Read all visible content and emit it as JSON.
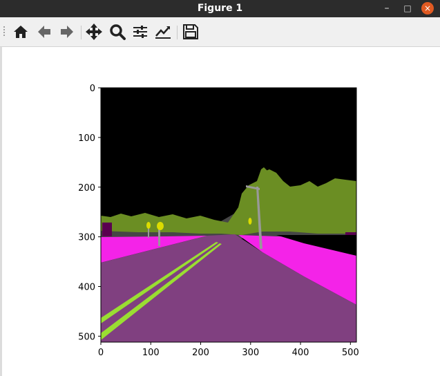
{
  "window": {
    "title": "Figure 1",
    "controls": {
      "minimize": "–",
      "maximize": "□",
      "close": "×"
    }
  },
  "toolbar": {
    "tools": [
      {
        "name": "home-icon",
        "tooltip": "Home"
      },
      {
        "name": "back-arrow-icon",
        "tooltip": "Back"
      },
      {
        "name": "forward-arrow-icon",
        "tooltip": "Forward"
      },
      {
        "name": "pan-move-icon",
        "tooltip": "Pan"
      },
      {
        "name": "zoom-magnifier-icon",
        "tooltip": "Zoom"
      },
      {
        "name": "subplots-sliders-icon",
        "tooltip": "Subplots"
      },
      {
        "name": "edit-axis-chart-icon",
        "tooltip": "Customize"
      },
      {
        "name": "save-floppy-icon",
        "tooltip": "Save"
      }
    ]
  },
  "figure": {
    "image_type": "semantic segmentation of road scene",
    "x_ticks": [
      "0",
      "100",
      "200",
      "300",
      "400",
      "500"
    ],
    "y_ticks": [
      "0",
      "100",
      "200",
      "300",
      "400",
      "500"
    ],
    "colors": {
      "sky": "#000000",
      "road": "#804080",
      "sidewalk": "#f423e8",
      "vegetation": "#6b8e23",
      "lane_marking": "#9ade32",
      "pole": "#999999",
      "traffic_sign": "#dcdc00",
      "building": "#464646",
      "fence": "#5a0050"
    }
  }
}
